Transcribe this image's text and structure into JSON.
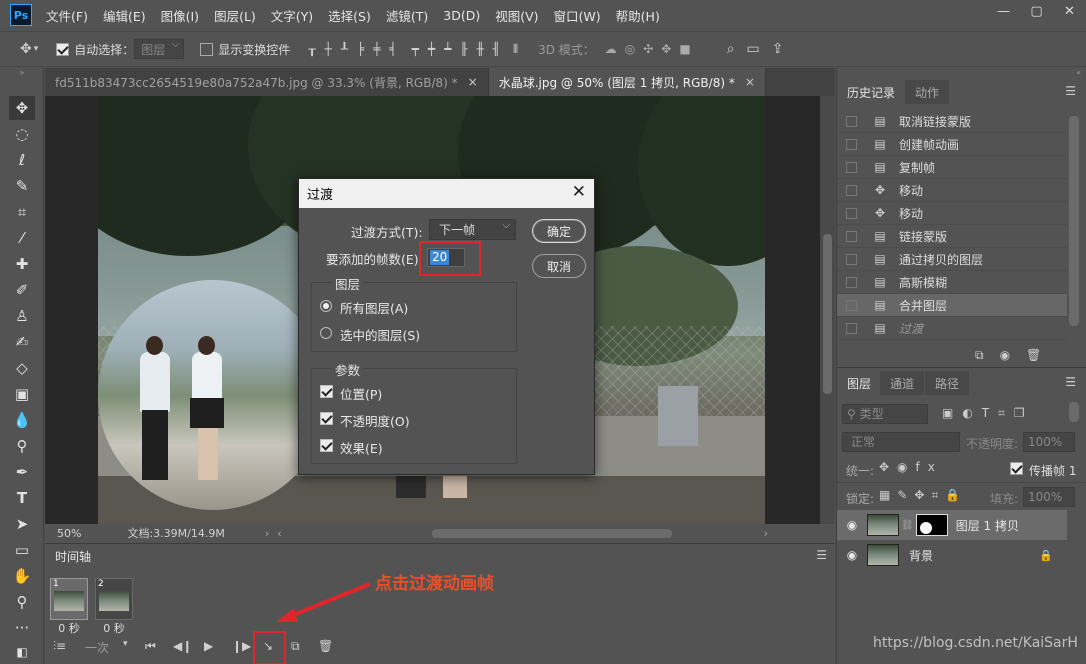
{
  "app": {
    "logo": "Ps"
  },
  "menu": [
    "文件(F)",
    "编辑(E)",
    "图像(I)",
    "图层(L)",
    "文字(Y)",
    "选择(S)",
    "滤镜(T)",
    "3D(D)",
    "视图(V)",
    "窗口(W)",
    "帮助(H)"
  ],
  "options": {
    "auto_select_label": "自动选择：",
    "auto_select_value": "图层",
    "show_transform_label": "显示变换控件",
    "mode3d_label": "3D 模式："
  },
  "doc_tabs": [
    {
      "label": "fd511b83473cc2654519e80a752a47b.jpg @ 33.3% (背景, RGB/8) *"
    },
    {
      "label": "水晶球.jpg @ 50% (图层 1 拷贝, RGB/8) *"
    }
  ],
  "status": {
    "zoom": "50%",
    "doc": "文档:3.39M/14.9M"
  },
  "timeline": {
    "tab": "时间轴",
    "frames": [
      {
        "num": "1",
        "delay": "0 秒"
      },
      {
        "num": "2",
        "delay": "0 秒"
      }
    ],
    "loop": "一次",
    "annotation": "点击过渡动画帧"
  },
  "history": {
    "tabs": [
      "历史记录",
      "动作"
    ],
    "items": [
      {
        "label": "取消链接蒙版",
        "icon": "doc"
      },
      {
        "label": "创建帧动画",
        "icon": "doc"
      },
      {
        "label": "复制帧",
        "icon": "doc"
      },
      {
        "label": "移动",
        "icon": "move"
      },
      {
        "label": "移动",
        "icon": "move"
      },
      {
        "label": "链接蒙版",
        "icon": "doc"
      },
      {
        "label": "通过拷贝的图层",
        "icon": "doc"
      },
      {
        "label": "高斯模糊",
        "icon": "doc"
      },
      {
        "label": "合并图层",
        "icon": "doc"
      },
      {
        "label": "过渡",
        "icon": "doc"
      }
    ]
  },
  "layers": {
    "tabs": [
      "图层",
      "通道",
      "路径"
    ],
    "filter_label": "类型",
    "blend_mode": "正常",
    "opacity_label": "不透明度:",
    "opacity_value": "100%",
    "unify_label": "统一:",
    "propagate_label": "传播帧 1",
    "lock_label": "锁定:",
    "fill_label": "填充:",
    "fill_value": "100%",
    "items": [
      {
        "name": "图层 1 拷贝"
      },
      {
        "name": "背景"
      }
    ]
  },
  "dialog": {
    "title": "过渡",
    "method_label": "过渡方式(T):",
    "method_value": "下一帧",
    "frames_label": "要添加的帧数(E)",
    "frames_value": "20",
    "ok": "确定",
    "cancel": "取消",
    "layers_group": "图层",
    "all_layers": "所有图层(A)",
    "selected_layers": "选中的图层(S)",
    "params_group": "参数",
    "position": "位置(P)",
    "opacity": "不透明度(O)",
    "effects": "效果(E)"
  },
  "watermark": "https://blog.csdn.net/KaiSarH",
  "colors": {
    "annotation": "#e8502a",
    "highlight_box": "#e0262a",
    "selection_blue": "#3b86d6"
  }
}
